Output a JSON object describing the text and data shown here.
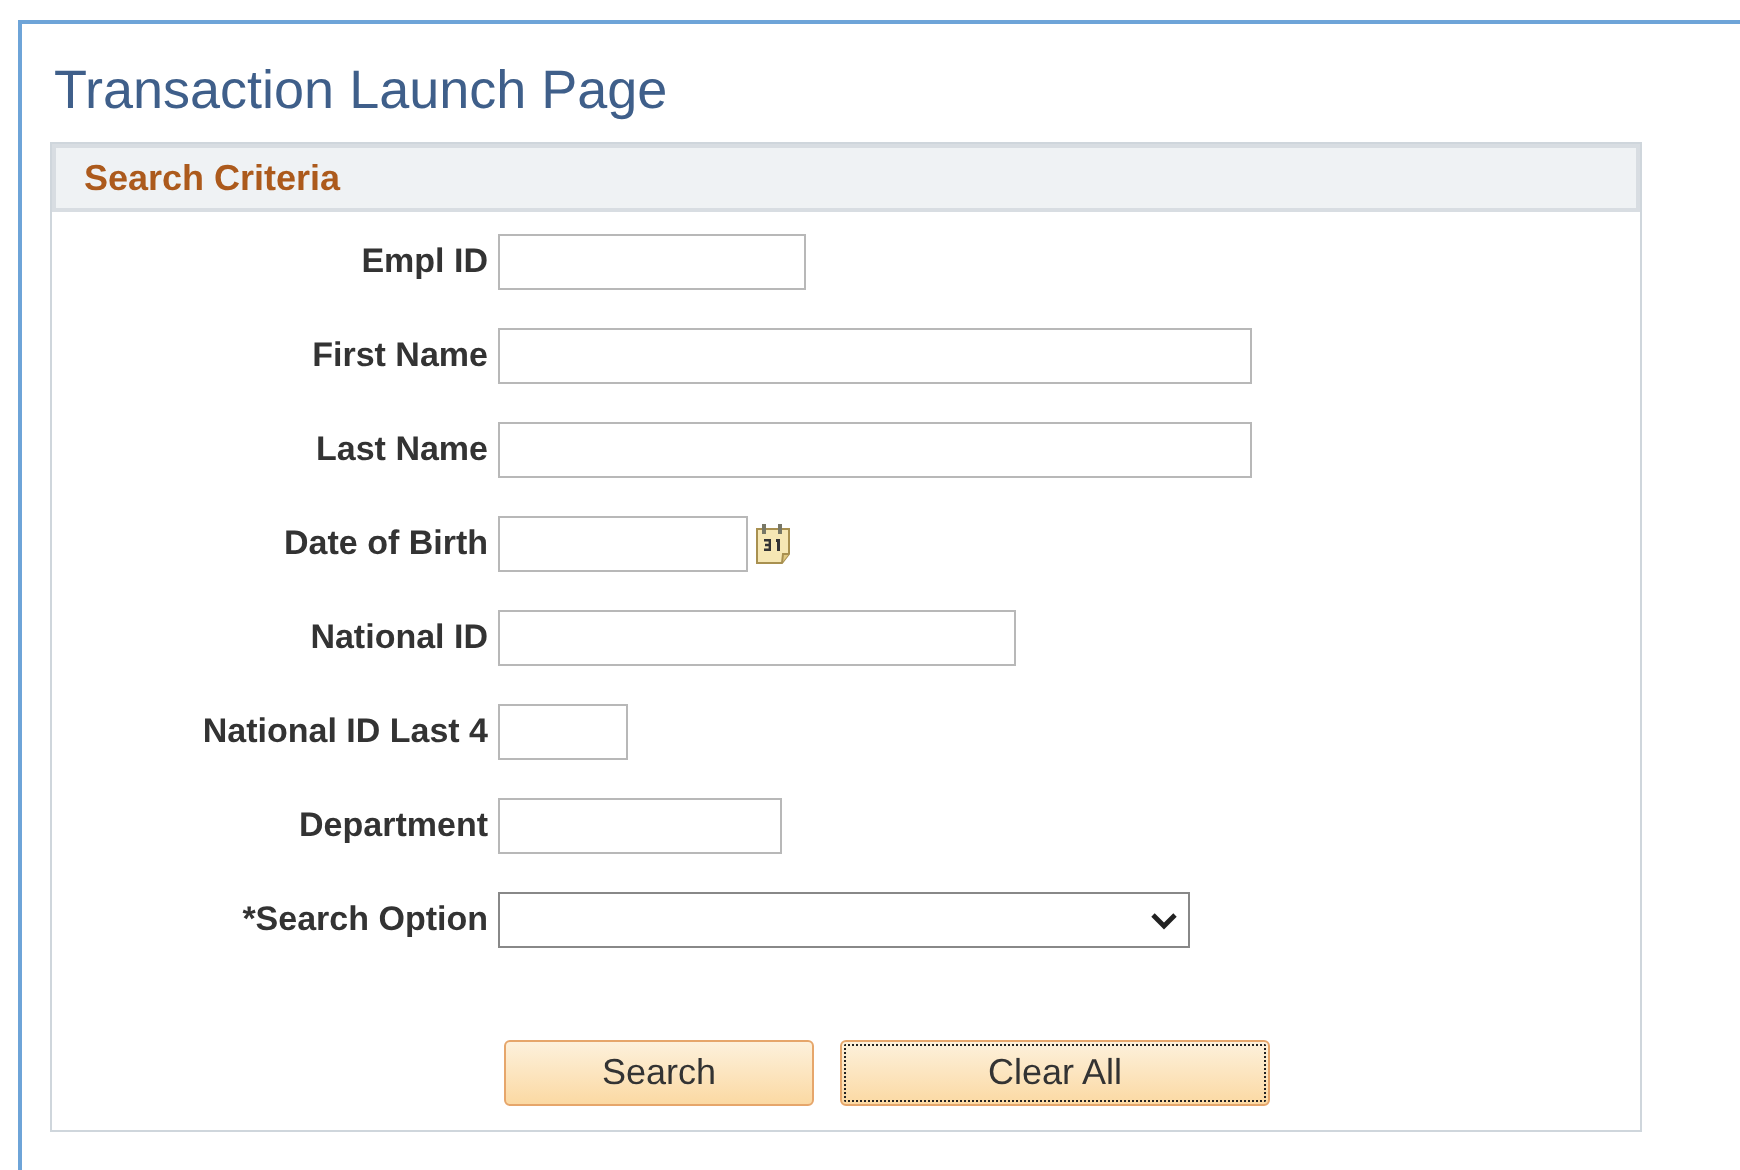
{
  "page": {
    "title": "Transaction Launch Page"
  },
  "search_criteria": {
    "heading": "Search Criteria",
    "fields": [
      {
        "label": "Empl ID",
        "kind": "text"
      },
      {
        "label": "First Name",
        "kind": "text"
      },
      {
        "label": "Last Name",
        "kind": "text"
      },
      {
        "label": "Date of Birth",
        "kind": "date"
      },
      {
        "label": "National ID",
        "kind": "text"
      },
      {
        "label": "National ID Last 4",
        "kind": "text"
      },
      {
        "label": "Department",
        "kind": "text"
      },
      {
        "label": "*Search Option",
        "kind": "select"
      }
    ],
    "buttons": [
      {
        "label": "Search",
        "focused": false
      },
      {
        "label": "Clear All",
        "focused": true
      }
    ]
  }
}
